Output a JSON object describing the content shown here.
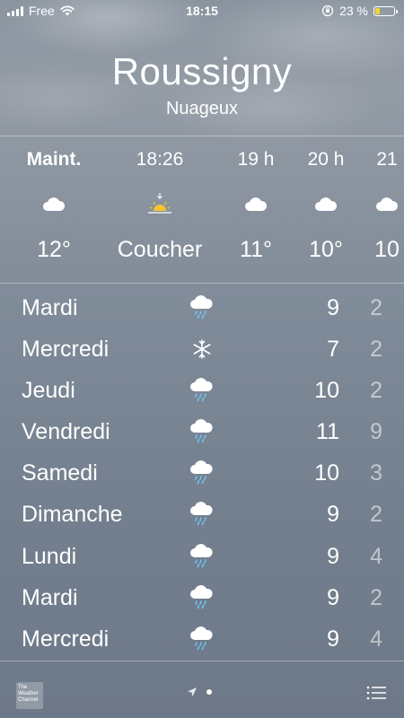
{
  "status_bar": {
    "carrier": "Free",
    "time": "18:15",
    "battery_percent": "23 %",
    "battery_level": 0.23
  },
  "location": {
    "city": "Roussigny",
    "condition": "Nuageux"
  },
  "hourly": [
    {
      "label": "Maint.",
      "icon": "cloud-icon",
      "temp": "12°"
    },
    {
      "label": "18:26",
      "icon": "sunset-icon",
      "temp": "Coucher"
    },
    {
      "label": "19 h",
      "icon": "cloud-icon",
      "temp": "11°"
    },
    {
      "label": "20 h",
      "icon": "cloud-icon",
      "temp": "10°"
    },
    {
      "label": "21",
      "icon": "cloud-icon",
      "temp": "10"
    }
  ],
  "daily": [
    {
      "day": "Mardi",
      "icon": "rain-cloud-icon",
      "hi": "9",
      "lo": "2"
    },
    {
      "day": "Mercredi",
      "icon": "snowflake-icon",
      "hi": "7",
      "lo": "2"
    },
    {
      "day": "Jeudi",
      "icon": "rain-cloud-icon",
      "hi": "10",
      "lo": "2"
    },
    {
      "day": "Vendredi",
      "icon": "rain-cloud-icon",
      "hi": "11",
      "lo": "9"
    },
    {
      "day": "Samedi",
      "icon": "rain-cloud-icon",
      "hi": "10",
      "lo": "3"
    },
    {
      "day": "Dimanche",
      "icon": "rain-cloud-icon",
      "hi": "9",
      "lo": "2"
    },
    {
      "day": "Lundi",
      "icon": "rain-cloud-icon",
      "hi": "9",
      "lo": "4"
    },
    {
      "day": "Mardi",
      "icon": "rain-cloud-icon",
      "hi": "9",
      "lo": "2"
    },
    {
      "day": "Mercredi",
      "icon": "rain-cloud-icon",
      "hi": "9",
      "lo": "4"
    }
  ],
  "bottom_bar": {
    "logo_text": "The Weather Channel"
  },
  "colors": {
    "battery": "#f5d33a",
    "sun": "#f5c430",
    "rain": "#6fc3f0"
  }
}
